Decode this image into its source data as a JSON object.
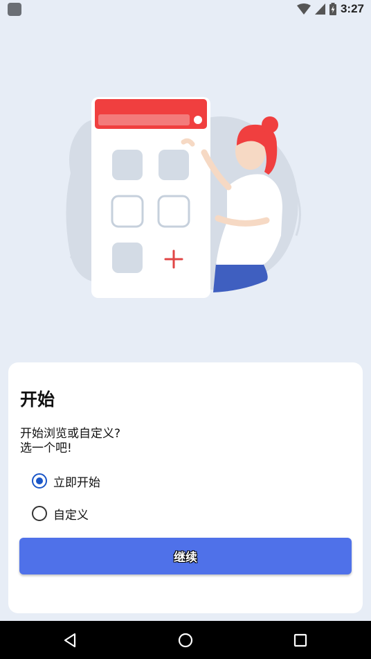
{
  "status_bar": {
    "time": "3:27"
  },
  "card": {
    "title": "开始",
    "description_line1": "开始浏览或自定义?",
    "description_line2": "选一个吧!",
    "options": [
      {
        "label": "立即开始",
        "selected": true
      },
      {
        "label": "自定义",
        "selected": false
      }
    ],
    "continue_label": "继续"
  },
  "colors": {
    "page_bg": "#e7edf6",
    "accent": "#4f71e9",
    "radio_selected": "#1a56c8",
    "illustration_red": "#f03f3f"
  },
  "icons": {
    "wifi": "wifi-icon",
    "signal": "cell-signal-icon",
    "battery": "battery-charging-icon",
    "back": "back-triangle-icon",
    "home": "home-circle-icon",
    "recents": "recents-square-icon"
  }
}
